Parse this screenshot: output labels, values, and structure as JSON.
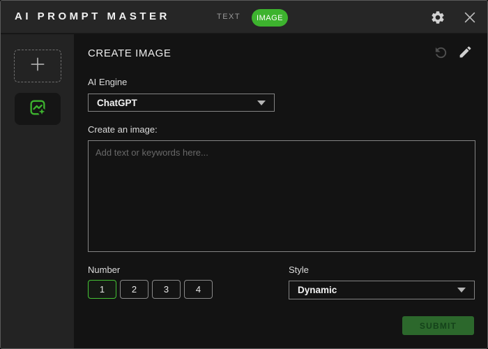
{
  "titlebar": {
    "app_title": "AI PROMPT MASTER",
    "tabs": [
      {
        "label": "TEXT",
        "active": false
      },
      {
        "label": "IMAGE",
        "active": true
      }
    ],
    "icons": [
      "gear-icon",
      "close-icon"
    ]
  },
  "sidebar": {
    "items": [
      {
        "name": "add-slot",
        "icon": "plus-icon",
        "active": false
      },
      {
        "name": "image-slot",
        "icon": "image-sparkle-icon",
        "active": true
      }
    ]
  },
  "main": {
    "heading": "CREATE IMAGE",
    "header_icons": [
      "undo-icon",
      "pencil-icon"
    ],
    "engine": {
      "label": "AI Engine",
      "value": "ChatGPT"
    },
    "prompt": {
      "label": "Create an image:",
      "placeholder": "Add text or keywords here..."
    },
    "number": {
      "label": "Number",
      "options": [
        "1",
        "2",
        "3",
        "4"
      ],
      "selected": "1"
    },
    "style": {
      "label": "Style",
      "value": "Dynamic"
    },
    "submit_label": "SUBMIT"
  },
  "colors": {
    "accent_green": "#3db32e",
    "tab_active_bg": "#3db32e",
    "submit_bg": "#2c682c",
    "submit_text": "#14421a",
    "titlebar_bg": "#262626",
    "sidebar_bg": "#232323",
    "main_bg": "#131313",
    "input_border": "#848484"
  }
}
